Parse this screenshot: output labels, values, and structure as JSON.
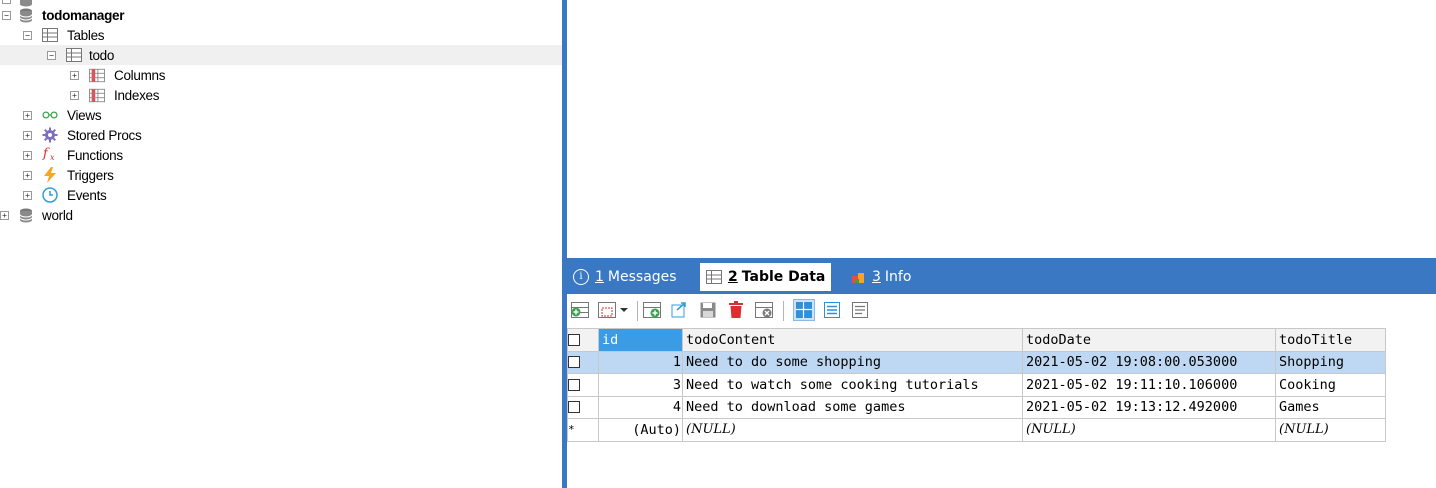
{
  "tree": {
    "items": [
      {
        "label": "todomanager",
        "bold": true
      },
      {
        "label": "Tables"
      },
      {
        "label": "todo"
      },
      {
        "label": "Columns"
      },
      {
        "label": "Indexes"
      },
      {
        "label": "Views"
      },
      {
        "label": "Stored Procs"
      },
      {
        "label": "Functions"
      },
      {
        "label": "Triggers"
      },
      {
        "label": "Events"
      },
      {
        "label": "world"
      }
    ]
  },
  "result_tabs": [
    {
      "num": "1",
      "label": "Messages"
    },
    {
      "num": "2",
      "label": "Table Data"
    },
    {
      "num": "3",
      "label": "Info"
    }
  ],
  "toolbar": {
    "icons": [
      "insert-row-icon",
      "duplicate-row-dropdown-icon",
      "save-new-row-icon",
      "refresh-icon",
      "save-icon",
      "delete-icon",
      "cancel-changes-icon",
      "grid-view-icon",
      "form-view-icon",
      "text-view-icon"
    ]
  },
  "grid": {
    "columns": [
      "id",
      "todoContent",
      "todoDate",
      "todoTitle"
    ],
    "rows": [
      {
        "id": "1",
        "todoContent": "Need to do some shopping",
        "todoDate": "2021-05-02 19:08:00.053000",
        "todoTitle": "Shopping"
      },
      {
        "id": "3",
        "todoContent": "Need to watch some cooking tutorials",
        "todoDate": "2021-05-02 19:11:10.106000",
        "todoTitle": "Cooking"
      },
      {
        "id": "4",
        "todoContent": "Need to download some games",
        "todoDate": "2021-05-02 19:13:12.492000",
        "todoTitle": "Games"
      }
    ],
    "new_row": {
      "marker": "*",
      "id": "(Auto)",
      "todoContent": "(NULL)",
      "todoDate": "(NULL)",
      "todoTitle": "(NULL)"
    }
  },
  "colors": {
    "accent": "#3a78c3",
    "selected_row": "#bed8f3",
    "header_selected": "#3a9be6"
  }
}
